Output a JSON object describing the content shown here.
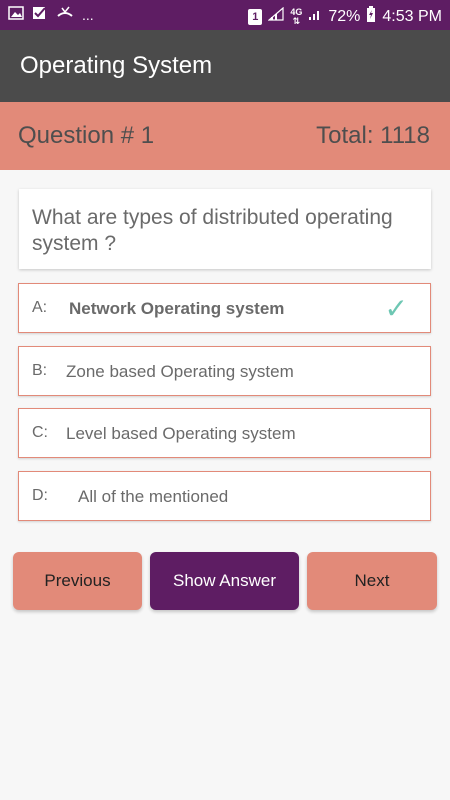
{
  "status_bar": {
    "left_icons": [
      "image-icon",
      "app-icon",
      "missed-call-icon"
    ],
    "ellipsis": "...",
    "sim_badge": "1",
    "network": "4G",
    "battery_percent": "72%",
    "time": "4:53 PM"
  },
  "app_bar": {
    "title": "Operating System"
  },
  "question_header": {
    "number_label": "Question # 1",
    "total_label": "Total: 1118"
  },
  "question": {
    "text": "What are types of distributed operating system ?"
  },
  "options": [
    {
      "letter": "A:",
      "label": "Network Operating system",
      "correct": true
    },
    {
      "letter": "B:",
      "label": "Zone based Operating system",
      "correct": false
    },
    {
      "letter": "C:",
      "label": "Level based Operating system",
      "correct": false
    },
    {
      "letter": "D:",
      "label": "All of the mentioned",
      "correct": false
    }
  ],
  "buttons": {
    "previous": "Previous",
    "show_answer": "Show Answer",
    "next": "Next"
  },
  "colors": {
    "status_bar": "#5e1d63",
    "app_bar": "#4b4b4b",
    "accent": "#e28a79",
    "primary": "#5e1d63",
    "check": "#6ec7b3"
  }
}
